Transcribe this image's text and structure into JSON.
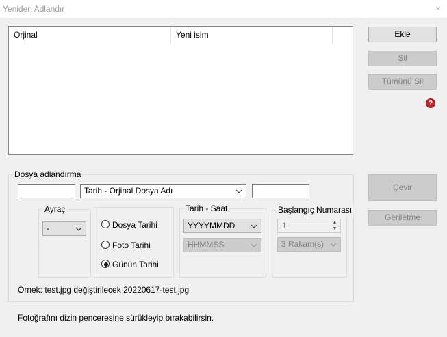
{
  "window": {
    "title": "Yeniden Adlandır",
    "close_glyph": "×"
  },
  "list": {
    "columns": [
      "Orjinal",
      "Yeni isim"
    ]
  },
  "buttons": {
    "add": "Ekle",
    "delete": "Sil",
    "delete_all": "Tümünü Sil",
    "convert": "Çevir",
    "undo": "Geriletme"
  },
  "naming": {
    "group_label": "Dosya adlandırma",
    "prefix_value": "",
    "format_selected": "Tarih - Orjinal Dosya Adı",
    "suffix_value": ""
  },
  "separator": {
    "label": "Ayraç",
    "selected": "-"
  },
  "date_source": {
    "options": [
      "Dosya Tarihi",
      "Foto Tarihi",
      "Günün Tarihi"
    ],
    "selected_index": 2
  },
  "datetime": {
    "label": "Tarih - Saat",
    "date_format": "YYYYMMDD",
    "time_format": "HHMMSS"
  },
  "start_number": {
    "label": "Başlangıç Numarası",
    "value": "1",
    "digits": "3 Rakam(s)"
  },
  "example": "Örnek: test.jpg değiştirilecek 20220617-test.jpg",
  "hint": "Fotoğrafını dizin penceresine sürükleyip bırakabilirsin.",
  "icons": {
    "help": "help-icon"
  },
  "colors": {
    "help_icon": "#c0252d",
    "disabled_text": "#838383"
  }
}
